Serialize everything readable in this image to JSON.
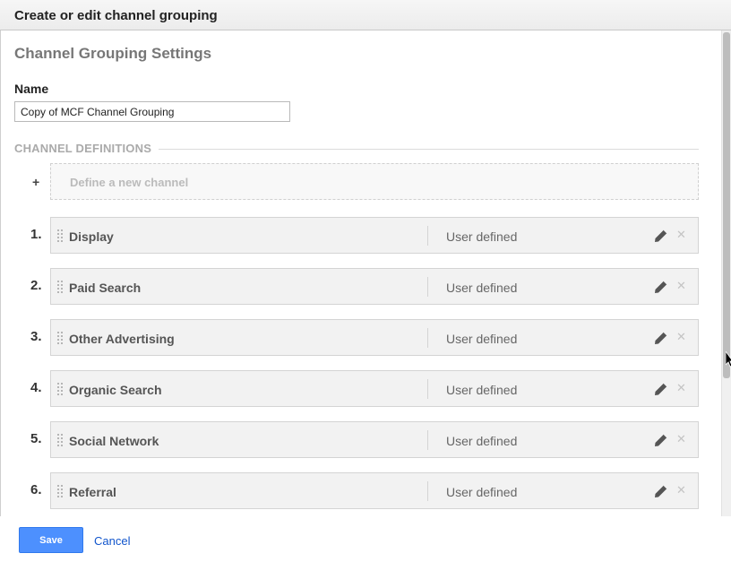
{
  "dialog": {
    "title": "Create or edit channel grouping"
  },
  "settings": {
    "title": "Channel Grouping Settings",
    "name_label": "Name",
    "name_value": "Copy of MCF Channel Grouping"
  },
  "definitions": {
    "header": "CHANNEL DEFINITIONS",
    "add_symbol": "+",
    "add_label": "Define a new channel",
    "channels": [
      {
        "num": "1.",
        "name": "Display",
        "type": "User defined"
      },
      {
        "num": "2.",
        "name": "Paid Search",
        "type": "User defined"
      },
      {
        "num": "3.",
        "name": "Other Advertising",
        "type": "User defined"
      },
      {
        "num": "4.",
        "name": "Organic Search",
        "type": "User defined"
      },
      {
        "num": "5.",
        "name": "Social Network",
        "type": "User defined"
      },
      {
        "num": "6.",
        "name": "Referral",
        "type": "User defined"
      }
    ]
  },
  "footer": {
    "save_label": "Save",
    "cancel_label": "Cancel"
  },
  "icons": {
    "edit": "pencil-icon",
    "delete": "close-icon",
    "drag": "drag-handle-icon"
  },
  "colors": {
    "primary_button": "#4d90fe",
    "link": "#1155cc"
  }
}
